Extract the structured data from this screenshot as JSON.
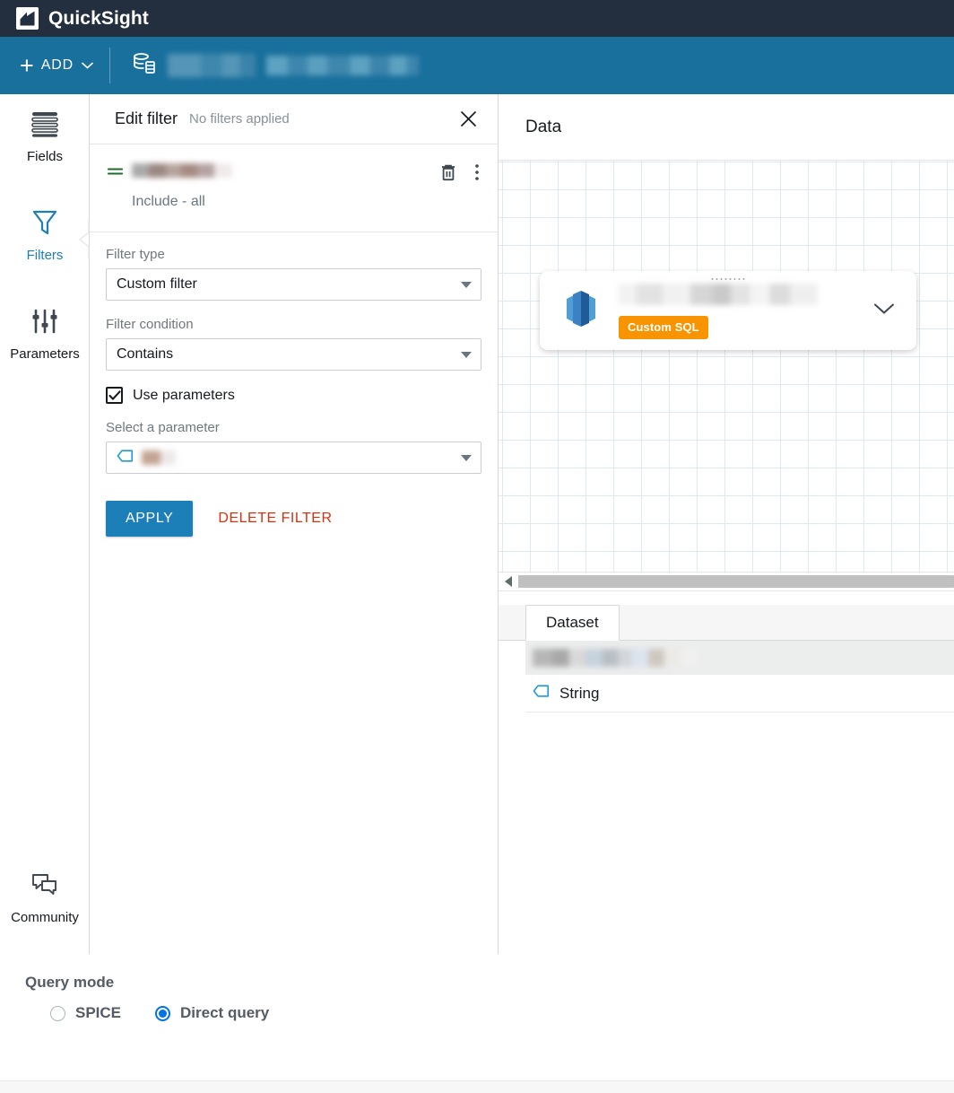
{
  "brand": {
    "logo_icon": "quicksight-logo-icon",
    "name": "QuickSight"
  },
  "toolbar": {
    "add_label": "ADD",
    "add_icon": "plus-icon",
    "add_chevron_icon": "chevron-down-icon",
    "dataset_icon": "database-icon",
    "dataset_name_redacted": "",
    "dataset_meta_redacted": ""
  },
  "rail": {
    "items": [
      {
        "label": "Fields",
        "icon": "fields-icon",
        "active": false
      },
      {
        "label": "Filters",
        "icon": "filter-funnel-icon",
        "active": true
      },
      {
        "label": "Parameters",
        "icon": "sliders-icon",
        "active": false
      }
    ],
    "community": {
      "label": "Community",
      "icon": "chat-bubbles-icon"
    },
    "collapse_icon": "chevron-left-icon"
  },
  "filter_panel": {
    "title": "Edit filter",
    "subtitle": "No filters applied",
    "close_icon": "close-icon",
    "filter_item": {
      "operator_icon": "equals-icon",
      "field_name_redacted": "",
      "state": "Include - all",
      "delete_icon": "trash-icon",
      "more_icon": "kebab-menu-icon"
    },
    "filter_type": {
      "label": "Filter type",
      "value": "Custom filter",
      "caret_icon": "caret-down-icon"
    },
    "filter_condition": {
      "label": "Filter condition",
      "value": "Contains",
      "caret_icon": "caret-down-icon"
    },
    "use_parameters": {
      "label": "Use parameters",
      "checked": true,
      "check_icon": "checkmark-icon"
    },
    "select_parameter": {
      "label": "Select a parameter",
      "value_redacted": "",
      "type_icon": "string-tag-icon",
      "caret_icon": "caret-down-icon"
    },
    "apply_label": "APPLY",
    "delete_label": "DELETE FILTER"
  },
  "data_pane": {
    "title": "Data",
    "node": {
      "source_icon": "redshift-icon",
      "drag_handle_icon": "drag-dots-icon",
      "title_redacted": "",
      "badge": "Custom SQL",
      "badge_color": "#f79400",
      "expand_icon": "chevron-down-icon"
    },
    "scrollbar": {
      "left_arrow_icon": "caret-left-icon",
      "thumb_name": "horizontal-scroll-thumb"
    },
    "tabs": [
      {
        "label": "Dataset",
        "active": true
      }
    ],
    "table": {
      "column_header_redacted": "",
      "rows": [
        {
          "type_icon": "string-tag-icon",
          "type": "String"
        }
      ]
    }
  },
  "footer": {
    "query_mode_label": "Query mode",
    "options": [
      {
        "label": "SPICE",
        "selected": false
      },
      {
        "label": "Direct query",
        "selected": true
      }
    ]
  },
  "colors": {
    "brand_bar": "#232f3e",
    "toolbar_blue": "#19709c",
    "accent_blue": "#1c7fb8",
    "danger_red": "#d13212",
    "badge_orange": "#f79400",
    "radio_blue": "#0073e6",
    "grid_line": "#dceaf4",
    "equals_green": "#1d6b2f"
  }
}
